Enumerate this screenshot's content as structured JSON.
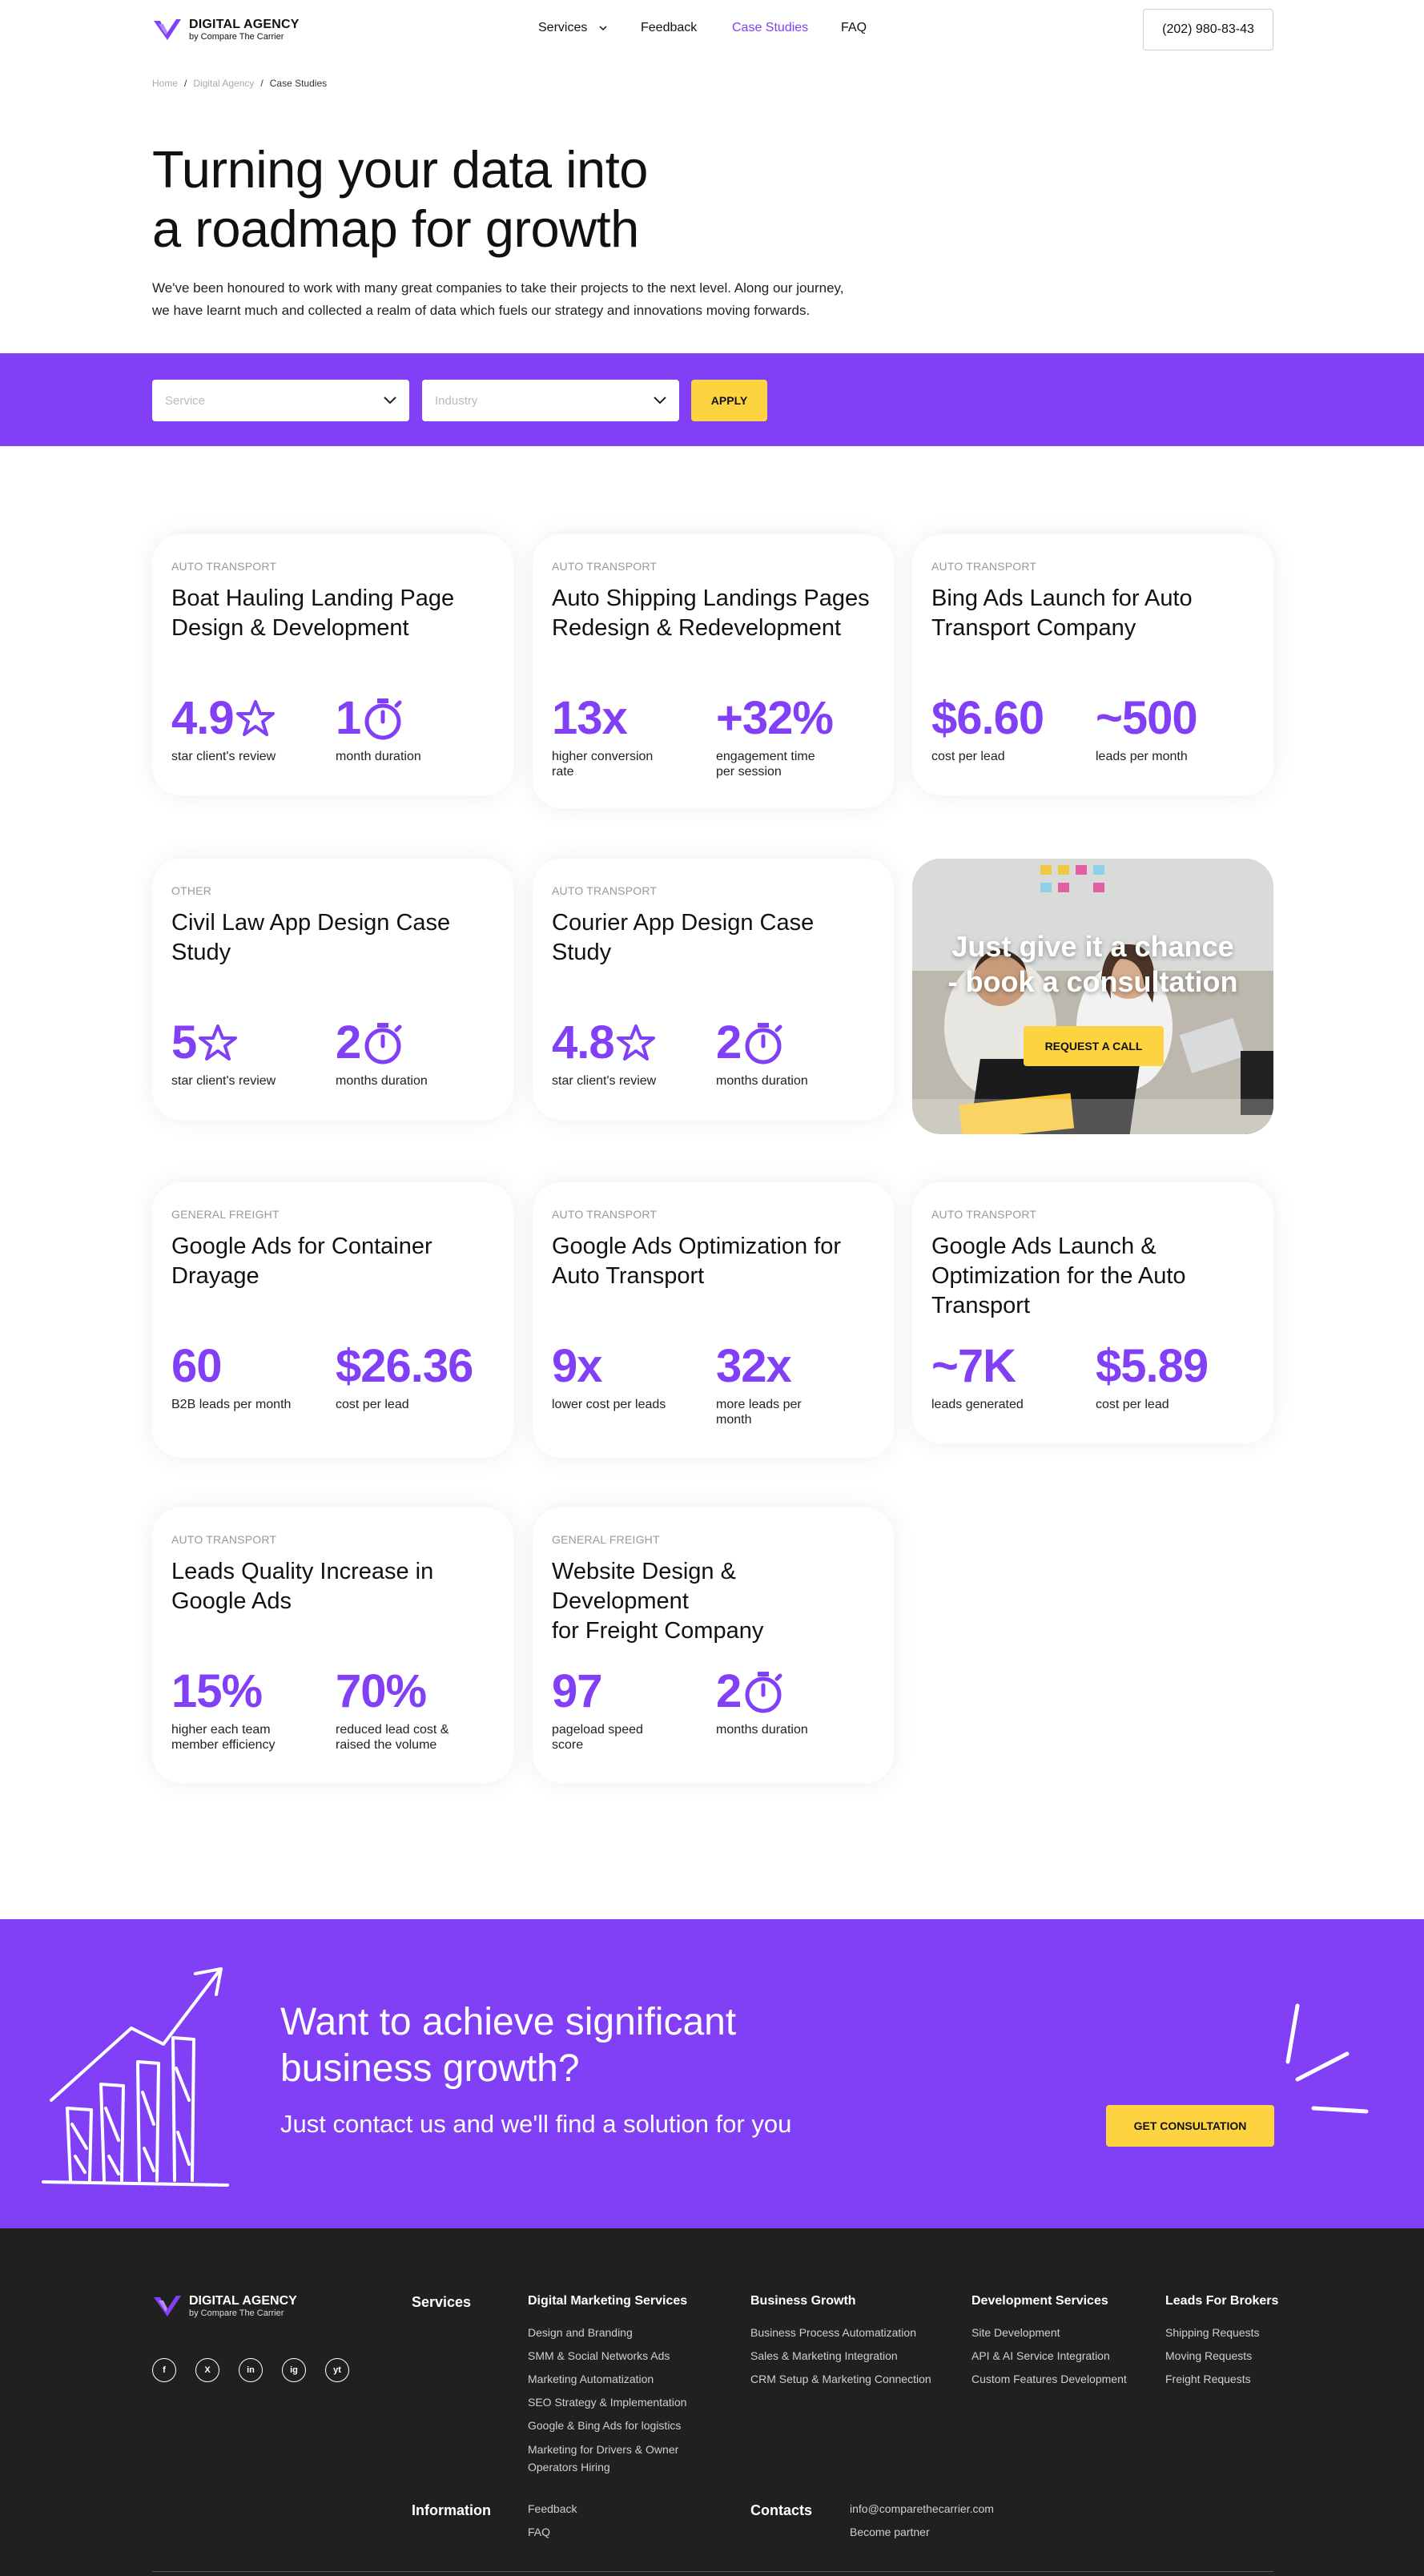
{
  "header": {
    "logo_title": "DIGITAL AGENCY",
    "logo_sub": "by Compare The Carrier",
    "nav": [
      {
        "label": "Services",
        "active": false
      },
      {
        "label": "Feedback",
        "active": false
      },
      {
        "label": "Case Studies",
        "active": true
      },
      {
        "label": "FAQ",
        "active": false
      }
    ],
    "phone": "(202) 980-83-43"
  },
  "breadcrumb": [
    "Home",
    "Digital Agency",
    "Case Studies"
  ],
  "hero": {
    "title_lines": [
      "Turning your data into",
      "a roadmap for growth"
    ],
    "sub_lines": [
      "We've been honoured to work with many great companies to take their projects to the next level. Along our journey,",
      "we have learnt much and collected a realm of data which fuels our strategy and innovations moving forwards."
    ]
  },
  "filter": {
    "service_placeholder": "Service",
    "industry_placeholder": "Industry",
    "apply_label": "APPLY"
  },
  "cards": [
    {
      "category": "AUTO TRANSPORT",
      "title_lines": [
        "Boat Hauling Landing Page",
        "Design & Development"
      ],
      "stats": [
        {
          "value": "4.9",
          "icon": "star-icon",
          "label": "star client's review"
        },
        {
          "value": "1",
          "icon": "stopwatch-icon",
          "label": "month duration"
        }
      ]
    },
    {
      "category": "AUTO TRANSPORT",
      "title_lines": [
        "Auto Shipping Landings Pages",
        "Redesign & Redevelopment"
      ],
      "stats": [
        {
          "value": "13x",
          "icon": "",
          "label": "higher conversion rate"
        },
        {
          "value": "+32%",
          "icon": "",
          "label": "engagement time per session"
        }
      ]
    },
    {
      "category": "AUTO TRANSPORT",
      "title_lines": [
        "Bing Ads Launch for Auto",
        "Transport Company"
      ],
      "stats": [
        {
          "value": "$6.60",
          "icon": "",
          "label": "cost per lead"
        },
        {
          "value": "~500",
          "icon": "",
          "label": "leads per month"
        }
      ]
    },
    {
      "category": "OTHER",
      "title_lines": [
        "Civil Law App Design Case",
        "Study"
      ],
      "stats": [
        {
          "value": "5",
          "icon": "star-icon",
          "label": "star client's review"
        },
        {
          "value": "2",
          "icon": "stopwatch-icon",
          "label": "months duration"
        }
      ]
    },
    {
      "category": "AUTO TRANSPORT",
      "title_lines": [
        "Courier App Design Case Study"
      ],
      "stats": [
        {
          "value": "4.8",
          "icon": "star-icon",
          "label": "star client's review"
        },
        {
          "value": "2",
          "icon": "stopwatch-icon",
          "label": "months duration"
        }
      ]
    },
    {
      "category": "GENERAL FREIGHT",
      "title_lines": [
        "Google Ads for Container",
        "Drayage"
      ],
      "stats": [
        {
          "value": "60",
          "icon": "",
          "label": "B2B leads per month"
        },
        {
          "value": "$26.36",
          "icon": "",
          "label": "cost per lead"
        }
      ]
    },
    {
      "category": "AUTO TRANSPORT",
      "title_lines": [
        "Google Ads Optimization for",
        "Auto Transport"
      ],
      "stats": [
        {
          "value": "9x",
          "icon": "",
          "label": "lower cost per leads"
        },
        {
          "value": "32x",
          "icon": "",
          "label": "more leads per month"
        }
      ]
    },
    {
      "category": "AUTO TRANSPORT",
      "title_lines": [
        "Google Ads Launch &",
        "Optimization for the Auto",
        "Transport"
      ],
      "stats": [
        {
          "value": "~7K",
          "icon": "",
          "label": "leads generated"
        },
        {
          "value": "$5.89",
          "icon": "",
          "label": "cost per lead"
        }
      ]
    },
    {
      "category": "AUTO TRANSPORT",
      "title_lines": [
        "Leads Quality Increase in",
        "Google Ads"
      ],
      "stats": [
        {
          "value": "15%",
          "icon": "",
          "label": "higher each team member efficiency"
        },
        {
          "value": "70%",
          "icon": "",
          "label": "reduced lead cost & raised the volume"
        }
      ]
    },
    {
      "category": "GENERAL FREIGHT",
      "title_lines": [
        "Website Design & Development",
        "for Freight Company"
      ],
      "stats": [
        {
          "value": "97",
          "icon": "",
          "label": "pageload speed score"
        },
        {
          "value": "2",
          "icon": "stopwatch-icon",
          "label": "months duration"
        }
      ]
    }
  ],
  "promo": {
    "title_lines": [
      "Just give it a chance",
      "- book a consultation"
    ],
    "button": "REQUEST A CALL"
  },
  "cta": {
    "title_lines": [
      "Want to achieve significant",
      "business growth?"
    ],
    "sub": "Just contact us and we'll find a solution for you",
    "button": "GET CONSULTATION"
  },
  "footer": {
    "logo_title": "DIGITAL AGENCY",
    "logo_sub": "by Compare The Carrier",
    "social": [
      "f",
      "X",
      "in",
      "ig",
      "yt"
    ],
    "services_heading": "Services",
    "columns": [
      {
        "heading": "Digital Marketing Services",
        "items": [
          "Design and Branding",
          "SMM & Social Networks Ads",
          "Marketing Automatization",
          "SEO Strategy & Implementation",
          "Google & Bing Ads for logistics",
          "Marketing for Drivers & Owner",
          "Operators Hiring"
        ]
      },
      {
        "heading": "Business Growth",
        "items": [
          "Business Process Automatization",
          "Sales & Marketing Integration",
          "CRM Setup & Marketing Connection"
        ]
      },
      {
        "heading": "Development Services",
        "items": [
          "Site Development",
          "API & AI Service Integration",
          "Custom Features Development"
        ]
      },
      {
        "heading": "Leads For Brokers",
        "items": [
          "Shipping Requests",
          "Moving Requests",
          "Freight Requests"
        ]
      }
    ],
    "information_heading": "Information",
    "information_items": [
      "Feedback",
      "FAQ"
    ],
    "contacts_heading": "Contacts",
    "contacts_items": [
      "info@comparethecarrier.com",
      "Become partner"
    ]
  },
  "colors": {
    "accent": "#8140f5",
    "yellow": "#fdd440",
    "footer_bg": "#202020"
  }
}
